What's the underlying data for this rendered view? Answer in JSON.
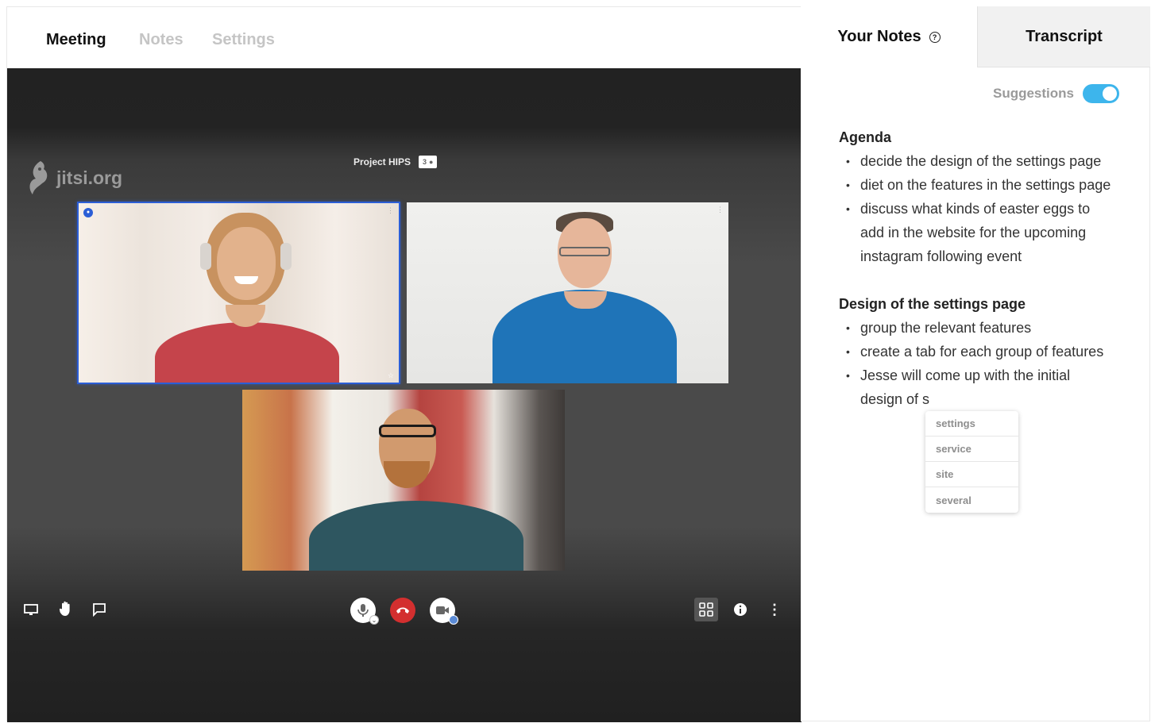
{
  "meeting_tabs": [
    {
      "label": "Meeting",
      "active": true
    },
    {
      "label": "Notes",
      "active": false
    },
    {
      "label": "Settings",
      "active": false
    }
  ],
  "video": {
    "logo_text": "jitsi.org",
    "room_title": "Project HIPS",
    "participant_count": "3"
  },
  "toolbar": {
    "left_icons": [
      "screen-share-icon",
      "raise-hand-icon",
      "chat-icon"
    ],
    "center_icons": [
      "microphone-icon",
      "hangup-icon",
      "camera-icon"
    ],
    "right_icons": [
      "tile-view-icon",
      "info-icon",
      "more-options-icon"
    ]
  },
  "notes_tabs": {
    "your_notes": "Your Notes",
    "transcript": "Transcript"
  },
  "suggestions": {
    "label": "Suggestions",
    "enabled": true,
    "accent_color": "#3db5ec"
  },
  "notes": {
    "agenda_heading": "Agenda",
    "agenda_items": [
      "decide the design of the settings page",
      "diet on the features in the settings page",
      "discuss what kinds of easter eggs to add in the website for the upcoming instagram following event"
    ],
    "design_heading": "Design of the settings page",
    "design_items": [
      "group the relevant features",
      "create a tab for each group of features",
      "Jesse will come up with the initial design of s"
    ]
  },
  "autocomplete": [
    "settings",
    "service",
    "site",
    "several"
  ]
}
